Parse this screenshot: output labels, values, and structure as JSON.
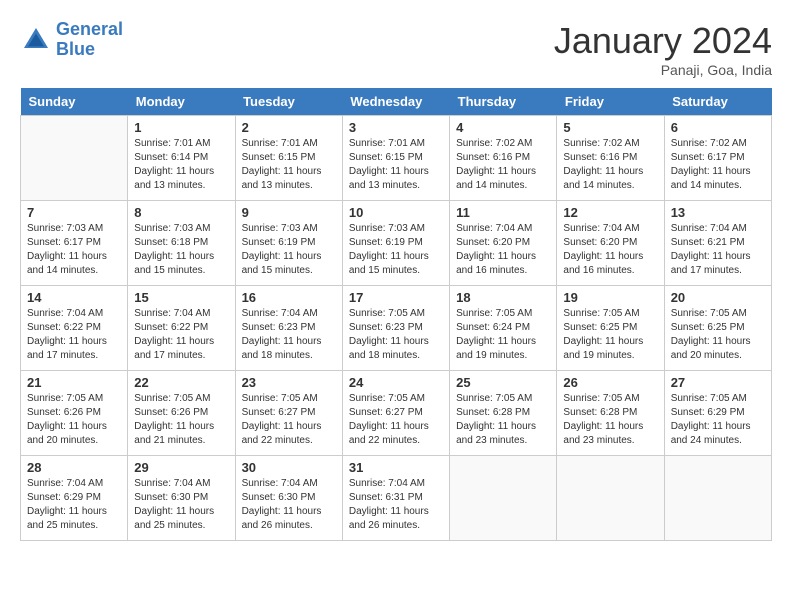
{
  "header": {
    "logo_line1": "General",
    "logo_line2": "Blue",
    "month_title": "January 2024",
    "subtitle": "Panaji, Goa, India"
  },
  "weekdays": [
    "Sunday",
    "Monday",
    "Tuesday",
    "Wednesday",
    "Thursday",
    "Friday",
    "Saturday"
  ],
  "weeks": [
    [
      {
        "day": "",
        "info": ""
      },
      {
        "day": "1",
        "info": "Sunrise: 7:01 AM\nSunset: 6:14 PM\nDaylight: 11 hours\nand 13 minutes."
      },
      {
        "day": "2",
        "info": "Sunrise: 7:01 AM\nSunset: 6:15 PM\nDaylight: 11 hours\nand 13 minutes."
      },
      {
        "day": "3",
        "info": "Sunrise: 7:01 AM\nSunset: 6:15 PM\nDaylight: 11 hours\nand 13 minutes."
      },
      {
        "day": "4",
        "info": "Sunrise: 7:02 AM\nSunset: 6:16 PM\nDaylight: 11 hours\nand 14 minutes."
      },
      {
        "day": "5",
        "info": "Sunrise: 7:02 AM\nSunset: 6:16 PM\nDaylight: 11 hours\nand 14 minutes."
      },
      {
        "day": "6",
        "info": "Sunrise: 7:02 AM\nSunset: 6:17 PM\nDaylight: 11 hours\nand 14 minutes."
      }
    ],
    [
      {
        "day": "7",
        "info": "Sunrise: 7:03 AM\nSunset: 6:17 PM\nDaylight: 11 hours\nand 14 minutes."
      },
      {
        "day": "8",
        "info": "Sunrise: 7:03 AM\nSunset: 6:18 PM\nDaylight: 11 hours\nand 15 minutes."
      },
      {
        "day": "9",
        "info": "Sunrise: 7:03 AM\nSunset: 6:19 PM\nDaylight: 11 hours\nand 15 minutes."
      },
      {
        "day": "10",
        "info": "Sunrise: 7:03 AM\nSunset: 6:19 PM\nDaylight: 11 hours\nand 15 minutes."
      },
      {
        "day": "11",
        "info": "Sunrise: 7:04 AM\nSunset: 6:20 PM\nDaylight: 11 hours\nand 16 minutes."
      },
      {
        "day": "12",
        "info": "Sunrise: 7:04 AM\nSunset: 6:20 PM\nDaylight: 11 hours\nand 16 minutes."
      },
      {
        "day": "13",
        "info": "Sunrise: 7:04 AM\nSunset: 6:21 PM\nDaylight: 11 hours\nand 17 minutes."
      }
    ],
    [
      {
        "day": "14",
        "info": "Sunrise: 7:04 AM\nSunset: 6:22 PM\nDaylight: 11 hours\nand 17 minutes."
      },
      {
        "day": "15",
        "info": "Sunrise: 7:04 AM\nSunset: 6:22 PM\nDaylight: 11 hours\nand 17 minutes."
      },
      {
        "day": "16",
        "info": "Sunrise: 7:04 AM\nSunset: 6:23 PM\nDaylight: 11 hours\nand 18 minutes."
      },
      {
        "day": "17",
        "info": "Sunrise: 7:05 AM\nSunset: 6:23 PM\nDaylight: 11 hours\nand 18 minutes."
      },
      {
        "day": "18",
        "info": "Sunrise: 7:05 AM\nSunset: 6:24 PM\nDaylight: 11 hours\nand 19 minutes."
      },
      {
        "day": "19",
        "info": "Sunrise: 7:05 AM\nSunset: 6:25 PM\nDaylight: 11 hours\nand 19 minutes."
      },
      {
        "day": "20",
        "info": "Sunrise: 7:05 AM\nSunset: 6:25 PM\nDaylight: 11 hours\nand 20 minutes."
      }
    ],
    [
      {
        "day": "21",
        "info": "Sunrise: 7:05 AM\nSunset: 6:26 PM\nDaylight: 11 hours\nand 20 minutes."
      },
      {
        "day": "22",
        "info": "Sunrise: 7:05 AM\nSunset: 6:26 PM\nDaylight: 11 hours\nand 21 minutes."
      },
      {
        "day": "23",
        "info": "Sunrise: 7:05 AM\nSunset: 6:27 PM\nDaylight: 11 hours\nand 22 minutes."
      },
      {
        "day": "24",
        "info": "Sunrise: 7:05 AM\nSunset: 6:27 PM\nDaylight: 11 hours\nand 22 minutes."
      },
      {
        "day": "25",
        "info": "Sunrise: 7:05 AM\nSunset: 6:28 PM\nDaylight: 11 hours\nand 23 minutes."
      },
      {
        "day": "26",
        "info": "Sunrise: 7:05 AM\nSunset: 6:28 PM\nDaylight: 11 hours\nand 23 minutes."
      },
      {
        "day": "27",
        "info": "Sunrise: 7:05 AM\nSunset: 6:29 PM\nDaylight: 11 hours\nand 24 minutes."
      }
    ],
    [
      {
        "day": "28",
        "info": "Sunrise: 7:04 AM\nSunset: 6:29 PM\nDaylight: 11 hours\nand 25 minutes."
      },
      {
        "day": "29",
        "info": "Sunrise: 7:04 AM\nSunset: 6:30 PM\nDaylight: 11 hours\nand 25 minutes."
      },
      {
        "day": "30",
        "info": "Sunrise: 7:04 AM\nSunset: 6:30 PM\nDaylight: 11 hours\nand 26 minutes."
      },
      {
        "day": "31",
        "info": "Sunrise: 7:04 AM\nSunset: 6:31 PM\nDaylight: 11 hours\nand 26 minutes."
      },
      {
        "day": "",
        "info": ""
      },
      {
        "day": "",
        "info": ""
      },
      {
        "day": "",
        "info": ""
      }
    ]
  ]
}
